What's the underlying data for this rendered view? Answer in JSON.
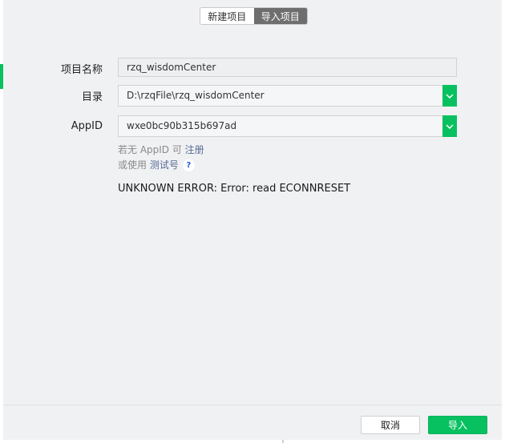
{
  "tabs": {
    "new_project": "新建项目",
    "import_project": "导入项目"
  },
  "form": {
    "project_name_label": "项目名称",
    "project_name_value": "rzq_wisdomCenter",
    "directory_label": "目录",
    "directory_value": "D:\\rzqFile\\rzq_wisdomCenter",
    "appid_label": "AppID",
    "appid_value": "wxe0bc90b315b697ad"
  },
  "hints": {
    "no_appid_text": "若无 AppID 可 ",
    "register_link": "注册",
    "or_use_text": "或使用 ",
    "test_account_link": "测试号",
    "help_glyph": "?"
  },
  "error_message": "UNKNOWN ERROR: Error: read ECONNRESET",
  "footer": {
    "cancel_label": "取消",
    "import_label": "导入"
  },
  "colors": {
    "accent": "#07c160",
    "link": "#576b95",
    "active_tab": "#6e6e6e"
  },
  "icons": {
    "dropdown": "chevron-down-icon",
    "help": "question-icon"
  }
}
